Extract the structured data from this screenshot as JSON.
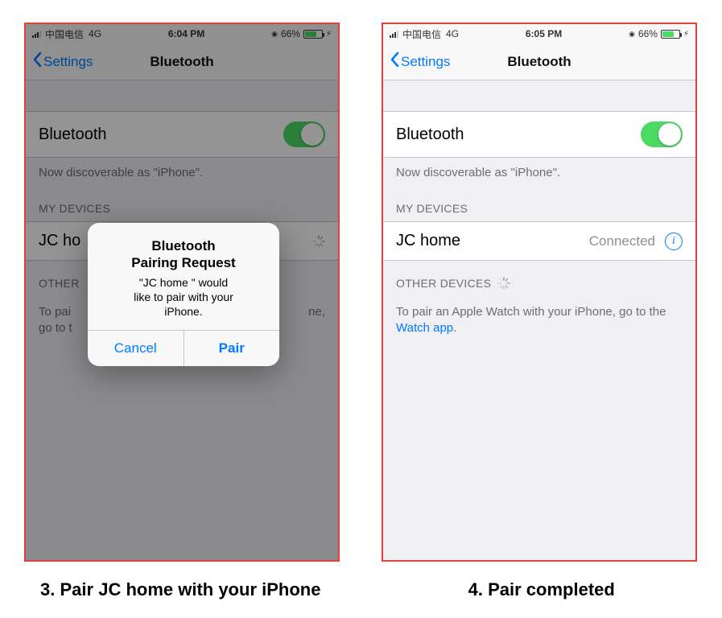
{
  "left": {
    "carrier_signal": ".ıl",
    "carrier": "中国电信",
    "network": "4G",
    "time": "6:04 PM",
    "gps_icon": "◉",
    "battery": "66%",
    "back_label": "Settings",
    "title": "Bluetooth",
    "bt_row_label": "Bluetooth",
    "discoverable": "Now discoverable as \"iPhone\".",
    "my_devices_header": "MY DEVICES",
    "device_name": "JC ho",
    "other_header": "OTHER",
    "help_pre": "To pai",
    "help_mid": "ne,",
    "help_post": "go to t",
    "alert": {
      "title_line1": "Bluetooth",
      "title_line2": "Pairing Request",
      "msg_line1": "\"JC home        \" would",
      "msg_line2": "like to pair with your",
      "msg_line3": "iPhone.",
      "cancel": "Cancel",
      "pair": "Pair"
    }
  },
  "right": {
    "carrier_signal": ".ıl",
    "carrier": "中国电信",
    "network": "4G",
    "time": "6:05 PM",
    "gps_icon": "◉",
    "battery": "66%",
    "back_label": "Settings",
    "title": "Bluetooth",
    "bt_row_label": "Bluetooth",
    "discoverable": "Now discoverable as \"iPhone\".",
    "my_devices_header": "MY DEVICES",
    "device_name": "JC home",
    "device_status": "Connected",
    "other_header": "OTHER DEVICES",
    "help_text_pre": "To pair an Apple Watch with your iPhone, go to the ",
    "help_link": "Watch app",
    "help_text_post": "."
  },
  "captions": {
    "left": "3. Pair JC home with your iPhone",
    "right": "4. Pair completed"
  }
}
